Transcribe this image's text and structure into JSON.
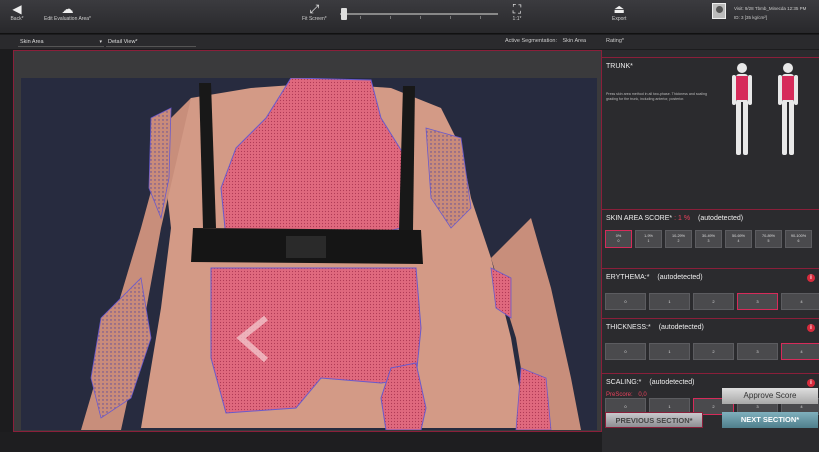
{
  "toolbar": {
    "back_label": "Back*",
    "edit_label": "Edit Evaluation Area*",
    "fit_label": "Fit Screen*",
    "zoom_label": "1:1*",
    "export_label": "Export",
    "user_line1": "Visit: 9/28 Tbmb_Minecda   12:35 PM",
    "user_line2": "ID: 3   [35 kg/cm²]"
  },
  "subbar": {
    "skin_area_select": "Skin Area",
    "detail_view_select": "Detail View*",
    "active_seg_label": "Active Segmentation:",
    "active_seg_value": "Skin Area",
    "rating_label": "Rating*"
  },
  "trunk": {
    "title": "TRUNK*",
    "description": "Press skin area method in all two-phase. Thickness and scaling grading for the trunk, including anterior, posterior."
  },
  "skin_area_score": {
    "label": "SKIN AREA SCORE*",
    "value": ": 1 %",
    "status": "(autodetected)",
    "options": [
      {
        "a": "0%",
        "b": "0"
      },
      {
        "a": "1-9%",
        "b": "1"
      },
      {
        "a": "10-29%",
        "b": "2"
      },
      {
        "a": "30-49%",
        "b": "3"
      },
      {
        "a": "50-69%",
        "b": "4"
      },
      {
        "a": "70-89%",
        "b": "5"
      },
      {
        "a": "90-100%",
        "b": "6"
      }
    ],
    "selected_index": 0
  },
  "erythema": {
    "label": "ERYTHEMA:*",
    "status": "(autodetected)",
    "options": [
      "0",
      "1",
      "2",
      "3",
      "4"
    ],
    "selected_index": 3
  },
  "thickness": {
    "label": "THICKNESS:*",
    "status": "(autodetected)",
    "options": [
      "0",
      "1",
      "2",
      "3",
      "4"
    ],
    "selected_index": 4
  },
  "scaling": {
    "label": "SCALING:*",
    "status": "(autodetected)",
    "options": [
      "0",
      "1",
      "2",
      "3",
      "4"
    ],
    "selected_index": 2
  },
  "footer": {
    "prescore_label": "PreScore:",
    "prescore_value": "0,0",
    "approve_label": "Approve Score",
    "prev_label": "PREVIOUS SECTION*",
    "next_label": "NEXT SECTION*"
  },
  "colors": {
    "accent": "#d62b5a",
    "lesion_overlay": "#e0607a",
    "segmentation_outline": "#6a5acd",
    "info_icon": "#d62b3c"
  }
}
